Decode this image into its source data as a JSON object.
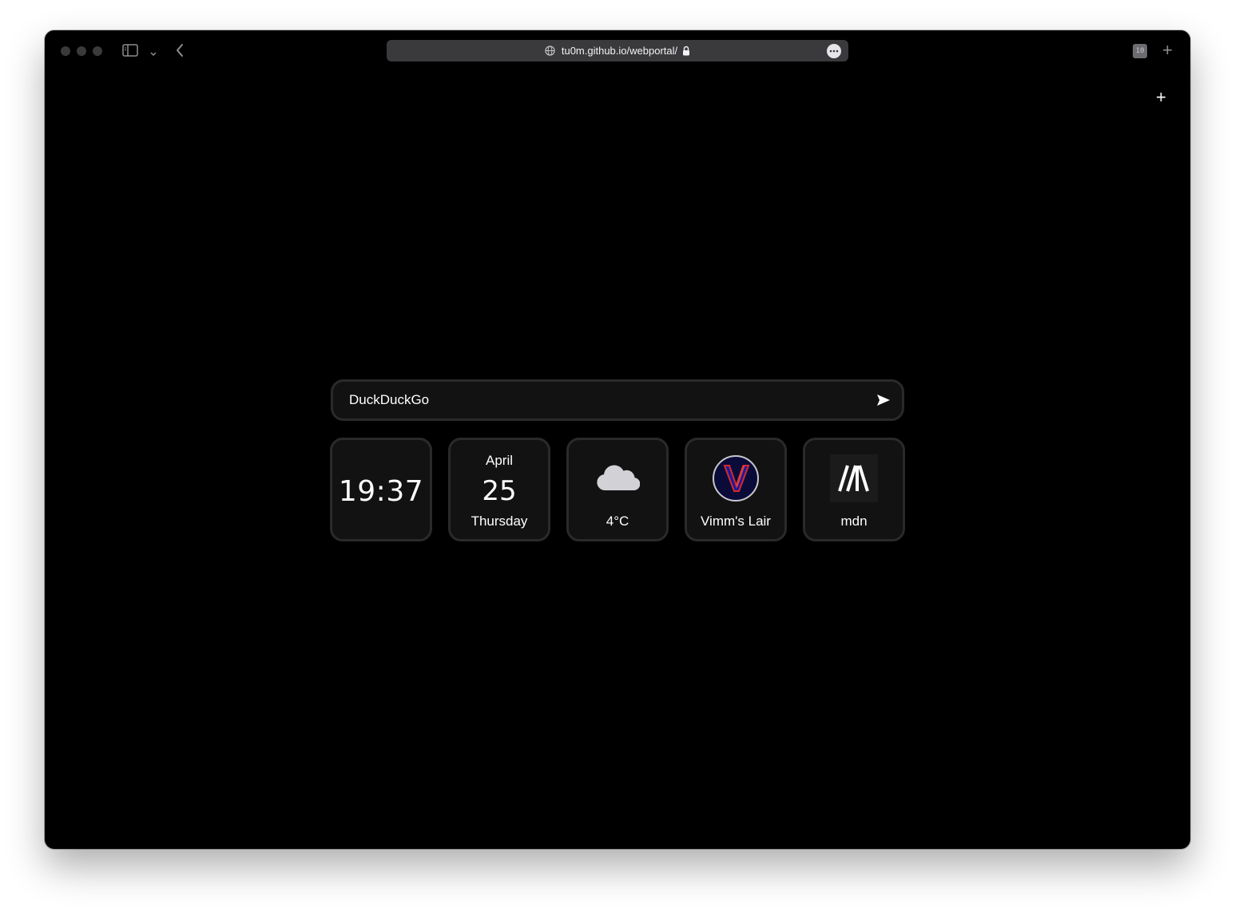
{
  "browser": {
    "url": "tu0m.github.io/webportal/",
    "tab_count": "10"
  },
  "search": {
    "placeholder": "DuckDuckGo"
  },
  "widgets": {
    "clock": "19:37",
    "date": {
      "month": "April",
      "day": "25",
      "weekday": "Thursday"
    },
    "weather": {
      "icon": "cloud-icon",
      "temperature": "4°C"
    }
  },
  "shortcuts": [
    {
      "label": "Vimm's Lair",
      "icon": "vimms-lair-logo"
    },
    {
      "label": "mdn",
      "icon": "mdn-logo"
    }
  ],
  "colors": {
    "page_background": "#000000",
    "tile_background": "#121212",
    "tile_border": "#2a2a2a",
    "text": "#ffffff"
  }
}
